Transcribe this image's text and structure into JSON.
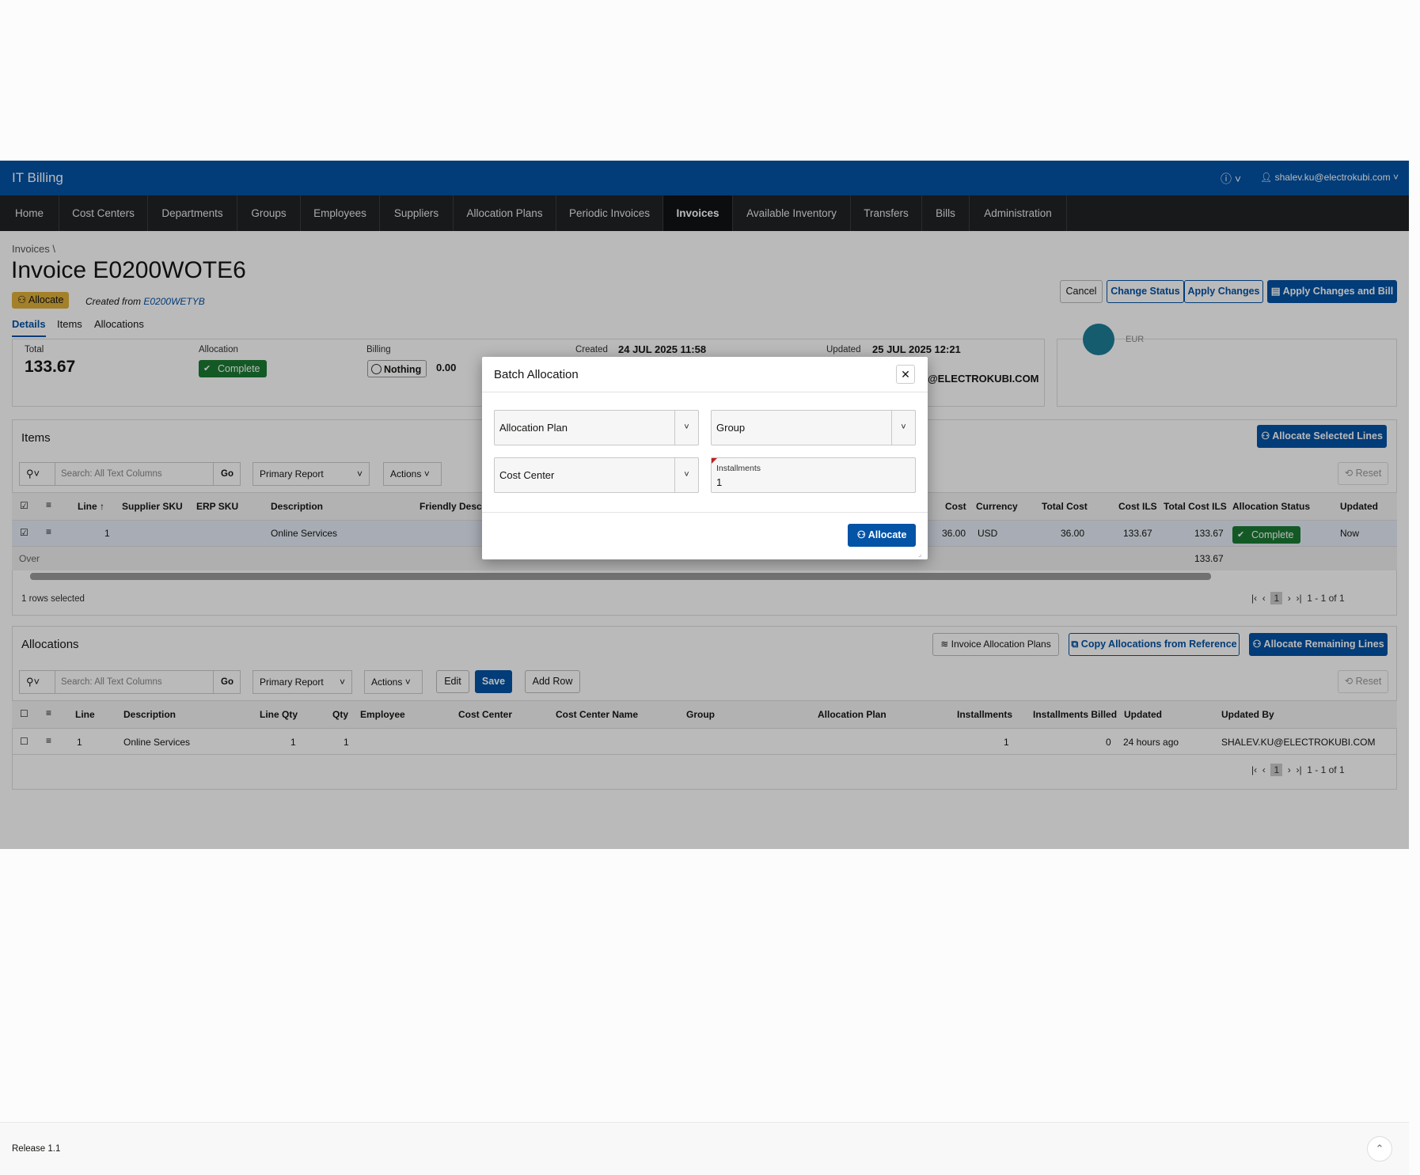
{
  "app": {
    "title": "IT Billing",
    "user": "shalev.ku@electrokubi.com",
    "help_icon": "help-circle-icon"
  },
  "nav": [
    "Home",
    "Cost Centers",
    "Departments",
    "Groups",
    "Employees",
    "Suppliers",
    "Allocation Plans",
    "Periodic Invoices",
    "Invoices",
    "Available Inventory",
    "Transfers",
    "Bills",
    "Administration"
  ],
  "nav_active": "Invoices",
  "breadcrumb": "Invoices",
  "page": {
    "title": "Invoice E0200WOTE6",
    "status_badge": "Allocate",
    "created_from_label": "Created from",
    "created_from_link": "E0200WETYB"
  },
  "subtabs": [
    "Details",
    "Items",
    "Allocations"
  ],
  "buttons": {
    "cancel": "Cancel",
    "change_status": "Change Status",
    "apply_changes": "Apply Changes",
    "apply_bill": "Apply Changes and Bill"
  },
  "summary": {
    "total_label": "Total",
    "total_value": "133.67",
    "allocation_label": "Allocation",
    "allocation_value": "Complete",
    "billing_label": "Billing",
    "billing_value": "Nothing",
    "billing_amount": "0.00",
    "created_label": "Created",
    "created_value": "24 JUL 2025 11:58",
    "updated_label": "Updated",
    "updated_value": "25 JUL 2025 12:21",
    "updated_by_partial": "@ELECTROKUBI.COM",
    "avatar_text": "EUR"
  },
  "items": {
    "title": "Items",
    "allocate_selected": "Allocate Selected Lines",
    "search_placeholder": "Search: All Text Columns",
    "go": "Go",
    "report": "Primary Report",
    "actions": "Actions",
    "reset": "Reset",
    "columns_left": [
      "Line",
      "Supplier SKU",
      "ERP SKU",
      "Description",
      "Friendly Descri"
    ],
    "columns_right": [
      "Cost",
      "Currency",
      "Total Cost",
      "Cost ILS",
      "Total Cost ILS",
      "Allocation Status",
      "Updated"
    ],
    "row": {
      "line": "1",
      "description": "Online Services",
      "cost": "36.00",
      "currency": "USD",
      "total_cost": "36.00",
      "cost_ils": "133.67",
      "total_cost_ils": "133.67",
      "status": "Complete",
      "updated": "Now"
    },
    "overall_label": "Over",
    "overall_total": "133.67",
    "selected_info": "1 rows selected",
    "page": "1",
    "range": "1 - 1 of 1"
  },
  "allocations": {
    "title": "Allocations",
    "invoice_plans": "Invoice Allocation Plans",
    "copy_ref": "Copy Allocations from Reference",
    "allocate_remaining": "Allocate Remaining Lines",
    "search_placeholder": "Search: All Text Columns",
    "go": "Go",
    "report": "Primary Report",
    "actions": "Actions",
    "edit": "Edit",
    "save": "Save",
    "add_row": "Add Row",
    "reset": "Reset",
    "columns": [
      "Line",
      "Description",
      "Line Qty",
      "Qty",
      "Employee",
      "Cost Center",
      "Cost Center Name",
      "Group",
      "Allocation Plan",
      "Installments",
      "Installments Billed",
      "Updated",
      "Updated By"
    ],
    "row": {
      "line": "1",
      "description": "Online Services",
      "line_qty": "1",
      "qty": "1",
      "installments": "1",
      "installments_billed": "0",
      "updated": "24 hours ago",
      "updated_by": "SHALEV.KU@ELECTROKUBI.COM"
    },
    "page": "1",
    "range": "1 - 1 of 1"
  },
  "dialog": {
    "title": "Batch Allocation",
    "allocation_plan": "Allocation Plan",
    "group": "Group",
    "cost_center": "Cost Center",
    "installments_label": "Installments",
    "installments_value": "1",
    "allocate": "Allocate"
  },
  "footer": {
    "release": "Release 1.1"
  },
  "colors": {
    "brand": "#0353a6",
    "nav": "#202326",
    "success": "#1b7a34",
    "warning": "#e0b03a"
  }
}
